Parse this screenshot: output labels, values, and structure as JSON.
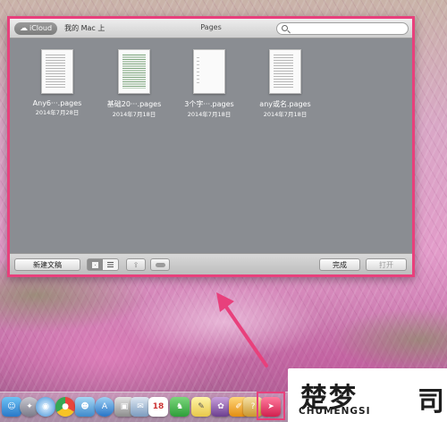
{
  "window": {
    "source_segments": [
      "iCloud",
      "我的 Mac 上"
    ],
    "title": "Pages",
    "search_placeholder": ""
  },
  "documents": [
    {
      "name": "Any6···.pages",
      "date": "2014年7月28日"
    },
    {
      "name": "基础20···.pages",
      "date": "2014年7月18日"
    },
    {
      "name": "3个字···.pages",
      "date": "2014年7月18日"
    },
    {
      "name": "any或名.pages",
      "date": "2014年7月18日"
    }
  ],
  "toolbar": {
    "new_document": "新建文稿",
    "done": "完成",
    "open": "打开"
  },
  "dock": {
    "calendar_day": "18",
    "icons": [
      "finder-icon",
      "launchpad-icon",
      "safari-icon",
      "chrome-icon",
      "finder2-icon",
      "app-store-icon",
      "preview-icon",
      "mail-icon",
      "calendar-icon",
      "evernote-icon",
      "stickies-icon",
      "photos-icon",
      "pages-icon",
      "keynote-icon",
      "highlighted-app-icon"
    ]
  },
  "watermark": {
    "chinese": "楚梦",
    "latin": "CHUMENGSI",
    "char2": "司"
  },
  "colors": {
    "highlight": "#e8407c",
    "window_bg": "#8a8d92"
  }
}
